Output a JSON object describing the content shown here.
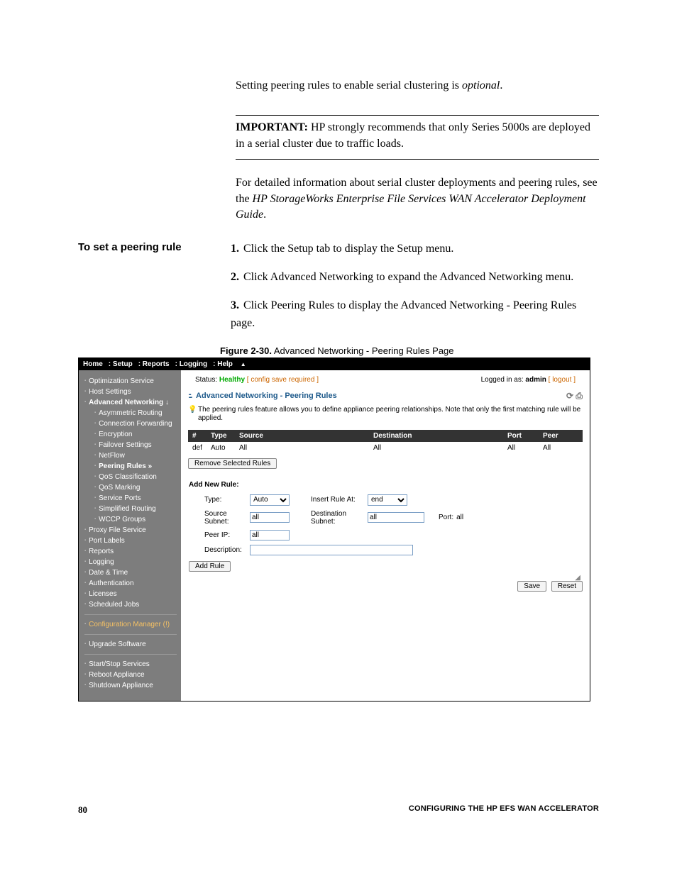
{
  "intro": {
    "p1a": "Setting peering rules to enable serial clustering is ",
    "p1b": "optional",
    "p1c": "."
  },
  "important": {
    "label": "IMPORTANT:",
    "text": " HP strongly recommends that only Series 5000s are deployed in a serial cluster due to traffic loads."
  },
  "detail": {
    "a": "For detailed information about serial cluster deployments and peering rules, see the ",
    "b": "HP StorageWorks Enterprise File Services WAN Accelerator Deployment Guide",
    "c": "."
  },
  "sectionHeading": "To set a peering rule",
  "steps": [
    "Click the Setup tab to display the Setup menu.",
    "Click Advanced Networking to expand the Advanced Networking menu.",
    "Click Peering Rules to display the Advanced Networking - Peering Rules page."
  ],
  "figcap": {
    "bold": "Figure 2-30.",
    "rest": " Advanced Networking - Peering Rules Page"
  },
  "shot": {
    "tabs": [
      "Home",
      "Setup",
      "Reports",
      "Logging",
      "Help"
    ],
    "status": {
      "label": "Status: ",
      "health": "Healthy",
      "note": " [ config save required ]",
      "logged": "Logged in as: ",
      "user": "admin",
      "logout": " [ logout ]"
    },
    "side": {
      "groups": [
        {
          "items": [
            "Optimization Service",
            "Host Settings"
          ],
          "bold": null
        },
        {
          "header": "Advanced Networking ↓",
          "subs": [
            "Asymmetric Routing",
            "Connection Forwarding",
            "Encryption",
            "Failover Settings",
            "NetFlow"
          ],
          "active": "Peering Rules »",
          "subs2": [
            "QoS Classification",
            "QoS Marking",
            "Service Ports",
            "Simplified Routing",
            "WCCP Groups"
          ]
        },
        {
          "items": [
            "Proxy File Service",
            "Port Labels",
            "Reports",
            "Logging",
            "Date & Time",
            "Authentication",
            "Licenses",
            "Scheduled Jobs"
          ]
        },
        {
          "items_warn": [
            "Configuration Manager  (!)"
          ]
        },
        {
          "items": [
            "Upgrade Software"
          ]
        },
        {
          "items": [
            "Start/Stop Services",
            "Reboot Appliance",
            "Shutdown Appliance"
          ]
        }
      ]
    },
    "crumb": "Advanced Networking - Peering Rules",
    "hint": "The peering rules feature allows you to define appliance peering relationships.\nNote that only the first matching rule will be applied.",
    "tbl": {
      "hdr": [
        "#",
        "Type",
        "Source",
        "Destination",
        "Port",
        "Peer"
      ],
      "row": [
        "def",
        "Auto",
        "All",
        "All",
        "All",
        "All"
      ]
    },
    "removeBtn": "Remove Selected Rules",
    "form": {
      "title": "Add New Rule:",
      "type": "Type:",
      "typeVal": "Auto",
      "insert": "Insert Rule At:",
      "insertVal": "end",
      "srcSub": "Source Subnet:",
      "srcSubVal": "all",
      "dstSub": "Destination Subnet:",
      "dstSubVal": "all",
      "port": "Port:",
      "portVal": "all",
      "peer": "Peer IP:",
      "peerVal": "all",
      "desc": "Description:",
      "descVal": "",
      "addBtn": "Add Rule"
    },
    "save": "Save",
    "reset": "Reset"
  },
  "footer": {
    "page": "80",
    "title": "CONFIGURING THE HP EFS WAN ACCELERATOR"
  }
}
